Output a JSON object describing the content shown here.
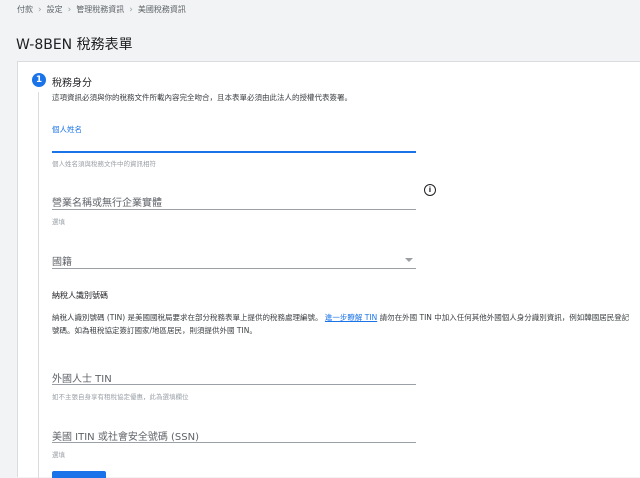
{
  "breadcrumb": {
    "items": [
      "付款",
      "設定",
      "管理稅務資訊",
      "美國稅務資訊"
    ],
    "separator": "›"
  },
  "page": {
    "title": "W-8BEN 稅務表單"
  },
  "step": {
    "number": "1",
    "title": "稅務身分",
    "description": "這項資訊必須與你的稅務文件所載內容完全吻合，且本表單必須由此法人的授權代表簽署。"
  },
  "fields": {
    "name": {
      "label": "個人姓名",
      "value": "",
      "helper": "個人姓名須與稅務文件中的資訊相符"
    },
    "business": {
      "placeholder": "營業名稱或無行企業實體",
      "helper": "選填"
    },
    "country": {
      "placeholder": "國籍"
    },
    "tin": {
      "heading": "納稅人識別號碼",
      "desc_before": "納稅人識別號碼 (TIN) 是美國國稅局要求在部分稅務表單上提供的稅務處理編號。",
      "link": "進一步瞭解 TIN",
      "desc_after": " 請勿在外國 TIN 中加入任何其他外國個人身分識別資訊，例如韓國居民登記號碼。如為租稅協定簽訂國家/地區居民，則須提供外國 TIN。"
    },
    "foreign_tin": {
      "placeholder": "外國人士 TIN",
      "helper": "如不主張自身享有租稅協定優惠，此為選填欄位"
    },
    "us_tin": {
      "placeholder": "美國 ITIN 或社會安全號碼 (SSN)",
      "helper": "選填"
    }
  },
  "icons": {
    "info": "info-icon",
    "dropdown": "chevron-down-icon"
  },
  "colors": {
    "accent": "#1a73e8",
    "background": "#f1f3f4"
  }
}
